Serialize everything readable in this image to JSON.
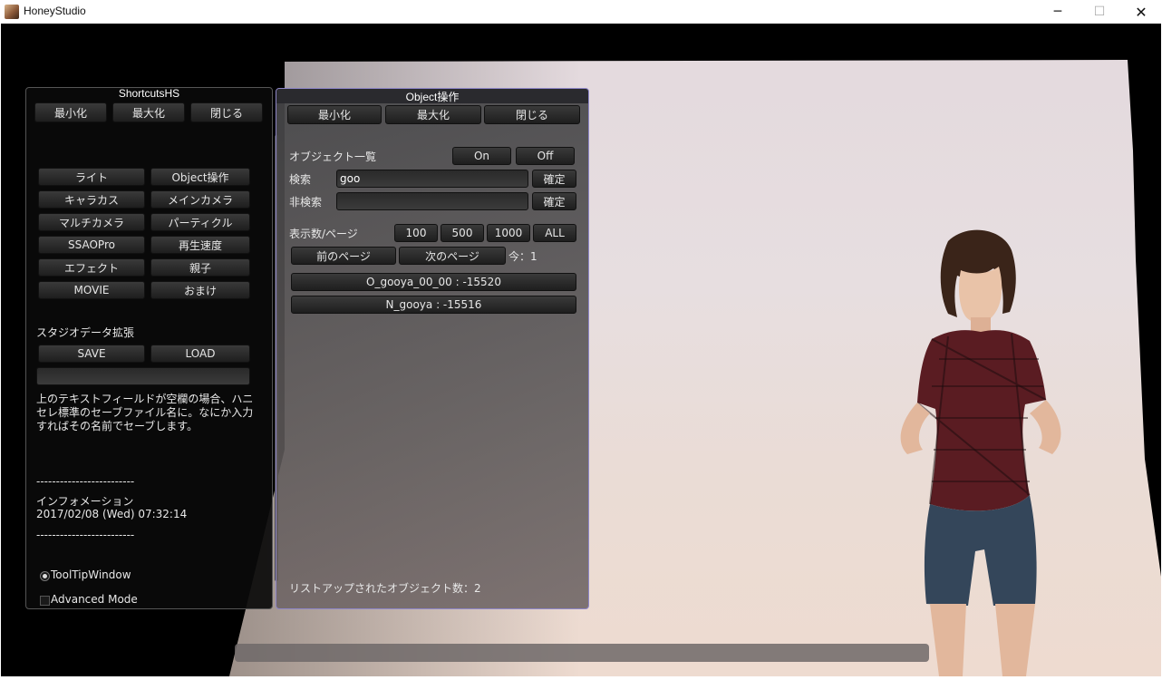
{
  "window": {
    "title": "HoneyStudio",
    "minimize_glyph": "─",
    "maximize_glyph": "☐",
    "close_glyph": "✕"
  },
  "shortcuts": {
    "title": "ShortcutsHS",
    "minimize": "最小化",
    "maximize": "最大化",
    "close": "閉じる",
    "grid": [
      "ライト",
      "Object操作",
      "キャラカス",
      "メインカメラ",
      "マルチカメラ",
      "パーティクル",
      "SSAOPro",
      "再生速度",
      "エフェクト",
      "親子",
      "MOVIE",
      "おまけ"
    ],
    "studio_ext_label": "スタジオデータ拡張",
    "save": "SAVE",
    "load": "LOAD",
    "save_name_value": "",
    "note": "上のテキストフィールドが空欄の場合、ハニセレ標準のセーブファイル名に。なにか入力すればその名前でセーブします。",
    "separator1": "-------------------------",
    "info_label": "インフォメーション",
    "info_datetime": "2017/02/08 (Wed) 07:32:14",
    "separator2": "-------------------------",
    "tooltip_option": "ToolTipWindow",
    "advanced_option": "Advanced Mode"
  },
  "object_panel": {
    "title": "Object操作",
    "minimize": "最小化",
    "maximize": "最大化",
    "close": "閉じる",
    "list_label": "オブジェクト一覧",
    "on": "On",
    "off": "Off",
    "search_label": "検索",
    "search_value": "goo",
    "confirm": "確定",
    "exclude_label": "非検索",
    "exclude_value": "",
    "per_page_label": "表示数/ページ",
    "per_page_options": [
      "100",
      "500",
      "1000",
      "ALL"
    ],
    "prev_page": "前のページ",
    "next_page": "次のページ",
    "current_page": "今：1",
    "results": [
      "O_gooya_00_00 : -15520",
      "N_gooya : -15516"
    ],
    "count_text": "リストアップされたオブジェクト数：2"
  },
  "colors": {
    "panel_border": "#8e86c8",
    "panel_bg": "#464648",
    "button_bg": "#2a2a2a"
  }
}
